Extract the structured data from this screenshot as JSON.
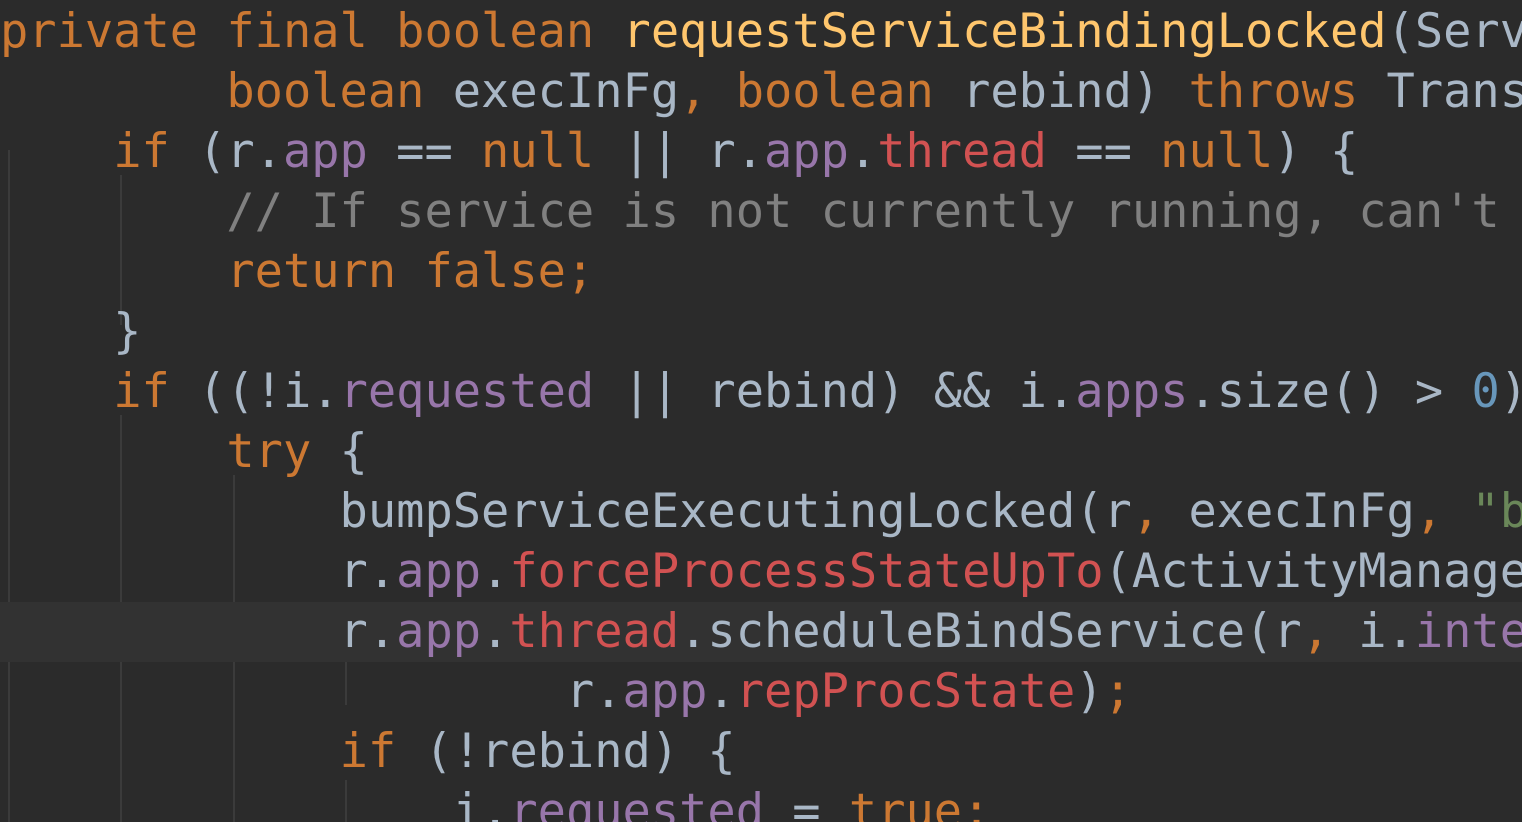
{
  "editor": {
    "lines": [
      [
        {
          "t": "private",
          "c": "keyword"
        },
        {
          "t": " ",
          "c": "plain"
        },
        {
          "t": "final",
          "c": "keyword"
        },
        {
          "t": " ",
          "c": "plain"
        },
        {
          "t": "boolean",
          "c": "keyword"
        },
        {
          "t": " ",
          "c": "plain"
        },
        {
          "t": "requestServiceBindingLocked",
          "c": "method"
        },
        {
          "t": "(Servi",
          "c": "plain"
        }
      ],
      [
        {
          "t": "        ",
          "c": "plain"
        },
        {
          "t": "boolean",
          "c": "keyword"
        },
        {
          "t": " execInFg",
          "c": "plain"
        },
        {
          "t": ",",
          "c": "punct"
        },
        {
          "t": " ",
          "c": "plain"
        },
        {
          "t": "boolean",
          "c": "keyword"
        },
        {
          "t": " rebind) ",
          "c": "plain"
        },
        {
          "t": "throws",
          "c": "keyword"
        },
        {
          "t": " Transa",
          "c": "plain"
        }
      ],
      [
        {
          "t": "    ",
          "c": "plain"
        },
        {
          "t": "if",
          "c": "keyword"
        },
        {
          "t": " (r.",
          "c": "plain"
        },
        {
          "t": "app",
          "c": "field"
        },
        {
          "t": " == ",
          "c": "plain"
        },
        {
          "t": "null",
          "c": "keyword"
        },
        {
          "t": " || r.",
          "c": "plain"
        },
        {
          "t": "app",
          "c": "field"
        },
        {
          "t": ".",
          "c": "plain"
        },
        {
          "t": "thread",
          "c": "static-field"
        },
        {
          "t": " == ",
          "c": "plain"
        },
        {
          "t": "null",
          "c": "keyword"
        },
        {
          "t": ") {",
          "c": "plain"
        }
      ],
      [
        {
          "t": "        ",
          "c": "plain"
        },
        {
          "t": "// If service is not currently running, can't y",
          "c": "comment"
        }
      ],
      [
        {
          "t": "        ",
          "c": "plain"
        },
        {
          "t": "return",
          "c": "keyword"
        },
        {
          "t": " ",
          "c": "plain"
        },
        {
          "t": "false",
          "c": "keyword"
        },
        {
          "t": ";",
          "c": "punct"
        }
      ],
      [
        {
          "t": "    }",
          "c": "plain"
        }
      ],
      [
        {
          "t": "    ",
          "c": "plain"
        },
        {
          "t": "if",
          "c": "keyword"
        },
        {
          "t": " ((!i.",
          "c": "plain"
        },
        {
          "t": "requested",
          "c": "field"
        },
        {
          "t": " || rebind) && i.",
          "c": "plain"
        },
        {
          "t": "apps",
          "c": "field"
        },
        {
          "t": ".size() > ",
          "c": "plain"
        },
        {
          "t": "0",
          "c": "number"
        },
        {
          "t": ")",
          "c": "plain"
        }
      ],
      [
        {
          "t": "        ",
          "c": "plain"
        },
        {
          "t": "try",
          "c": "keyword"
        },
        {
          "t": " {",
          "c": "plain"
        }
      ],
      [
        {
          "t": "            bumpServiceExecutingLocked(r",
          "c": "plain"
        },
        {
          "t": ",",
          "c": "punct"
        },
        {
          "t": " execInFg",
          "c": "plain"
        },
        {
          "t": ",",
          "c": "punct"
        },
        {
          "t": " ",
          "c": "plain"
        },
        {
          "t": "\"bi",
          "c": "string"
        }
      ],
      [
        {
          "t": "            r.",
          "c": "plain"
        },
        {
          "t": "app",
          "c": "field"
        },
        {
          "t": ".",
          "c": "plain"
        },
        {
          "t": "forceProcessStateUpTo",
          "c": "static-field"
        },
        {
          "t": "(ActivityManager",
          "c": "plain"
        }
      ],
      [
        {
          "t": "            r.",
          "c": "plain"
        },
        {
          "t": "app",
          "c": "field"
        },
        {
          "t": ".",
          "c": "plain"
        },
        {
          "t": "thread",
          "c": "static-field"
        },
        {
          "t": ".scheduleBindService(r",
          "c": "plain"
        },
        {
          "t": ",",
          "c": "punct"
        },
        {
          "t": " i.",
          "c": "plain"
        },
        {
          "t": "inter",
          "c": "field"
        }
      ],
      [
        {
          "t": "                    r.",
          "c": "plain"
        },
        {
          "t": "app",
          "c": "field"
        },
        {
          "t": ".",
          "c": "plain"
        },
        {
          "t": "repProcState",
          "c": "static-field"
        },
        {
          "t": ")",
          "c": "plain"
        },
        {
          "t": ";",
          "c": "punct"
        }
      ],
      [
        {
          "t": "            ",
          "c": "plain"
        },
        {
          "t": "if",
          "c": "keyword"
        },
        {
          "t": " (!rebind) {",
          "c": "plain"
        }
      ],
      [
        {
          "t": "                i.",
          "c": "plain"
        },
        {
          "t": "requested",
          "c": "field"
        },
        {
          "t": " = ",
          "c": "plain"
        },
        {
          "t": "true",
          "c": "keyword"
        },
        {
          "t": ";",
          "c": "punct"
        }
      ]
    ],
    "current_line": 10
  }
}
